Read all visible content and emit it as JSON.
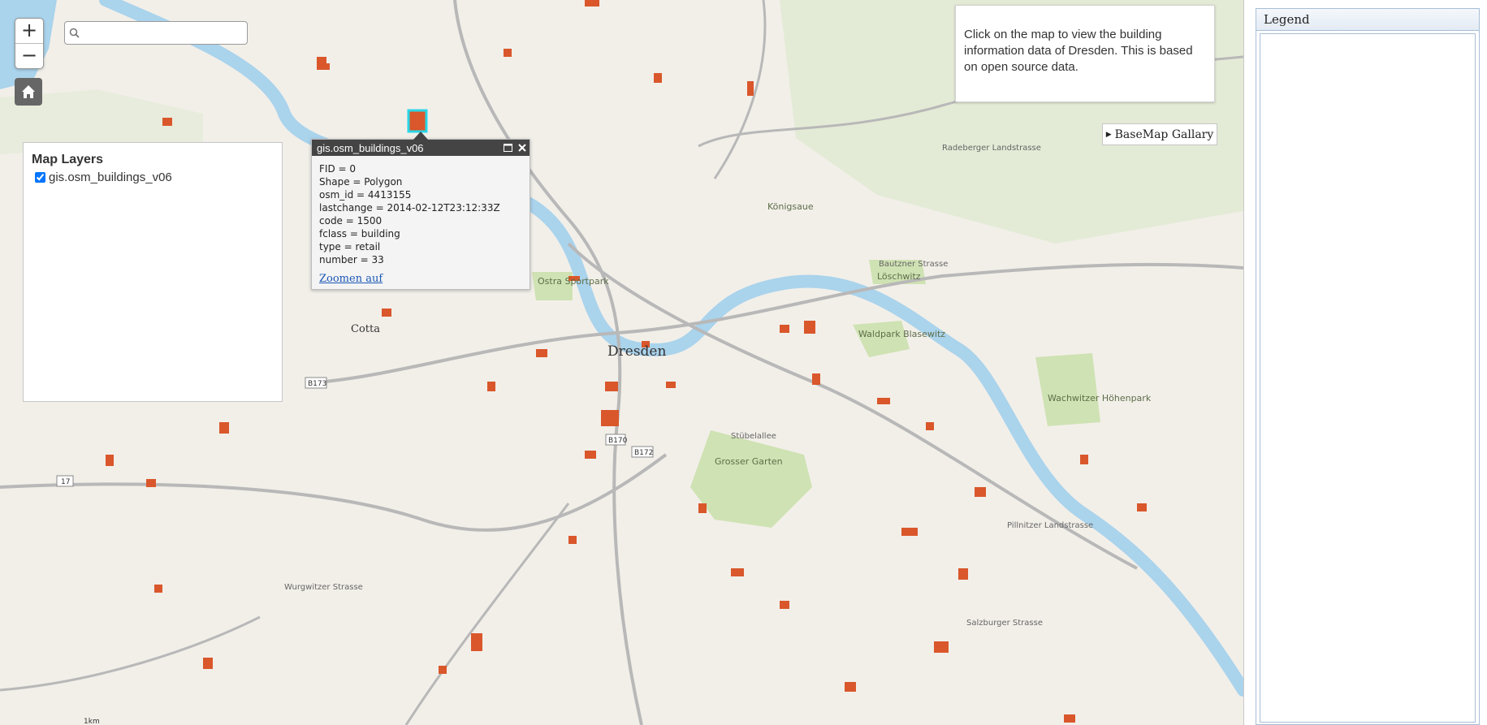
{
  "map": {
    "place_labels": [
      {
        "text": "Dresden"
      },
      {
        "text": "Cotta"
      },
      {
        "text": "Grosser Garten"
      },
      {
        "text": "Waldpark Blasewitz"
      },
      {
        "text": "Wachwitzer Höhenpark"
      },
      {
        "text": "Ostra Sportpark"
      },
      {
        "text": "Königsaue"
      },
      {
        "text": "Löschwitz"
      },
      {
        "text": "Bautzner Strasse"
      },
      {
        "text": "Radeberger Landstrasse"
      },
      {
        "text": "Stübelallee"
      },
      {
        "text": "Pillnitzer Landstrasse"
      },
      {
        "text": "Wurgwitzer Strasse"
      },
      {
        "text": "Salzburger Strasse"
      },
      {
        "text": "B173"
      },
      {
        "text": "B170"
      },
      {
        "text": "B172"
      },
      {
        "text": "17"
      },
      {
        "text": "1km"
      }
    ]
  },
  "zoom": {
    "in_label": "+",
    "out_label": "−"
  },
  "search": {
    "placeholder": ""
  },
  "layers_panel": {
    "title": "Map Layers",
    "layer_name": "gis.osm_buildings_v06",
    "checked": true
  },
  "popup": {
    "title": "gis.osm_buildings_v06",
    "fields": [
      "FID = 0",
      "Shape = Polygon",
      "osm_id = 4413155",
      "lastchange = 2014-02-12T23:12:33Z",
      "code = 1500",
      "fclass = building",
      "type = retail",
      "number = 33"
    ],
    "link": "Zoomen auf"
  },
  "info_box": {
    "text": "Click on the map to view the building information data of Dresden. This is based on open source data."
  },
  "basemap_button": {
    "label": "BaseMap Gallary"
  },
  "legend": {
    "title": "Legend"
  },
  "colors": {
    "building": "#d9572b",
    "river": "#aad3ec",
    "park": "#cfe2b3",
    "road": "#b8b8b8"
  }
}
